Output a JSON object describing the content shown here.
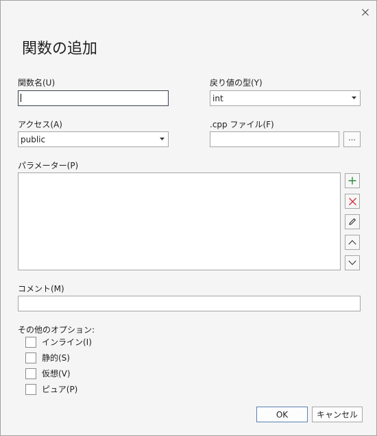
{
  "title": "関数の追加",
  "labels": {
    "function_name": "関数名(U)",
    "return_type": "戻り値の型(Y)",
    "access": "アクセス(A)",
    "cpp_file": ".cpp ファイル(F)",
    "parameters": "パラメーター(P)",
    "comment": "コメント(M)",
    "other_options": "その他のオプション:"
  },
  "fields": {
    "function_name": "",
    "return_type": "int",
    "access": "public",
    "cpp_file": "",
    "comment": ""
  },
  "browse_label": "...",
  "options": [
    {
      "label": "インライン(I)",
      "checked": false
    },
    {
      "label": "静的(S)",
      "checked": false
    },
    {
      "label": "仮想(V)",
      "checked": false
    },
    {
      "label": "ピュア(P)",
      "checked": false
    }
  ],
  "buttons": {
    "ok": "OK",
    "cancel": "キャンセル"
  },
  "icons": {
    "close": "close-icon",
    "add": "plus-icon",
    "remove": "x-icon",
    "edit": "pencil-icon",
    "up": "chevron-up-icon",
    "down": "chevron-down-icon"
  },
  "colors": {
    "add": "#2e8b3a",
    "remove": "#d62d3a"
  }
}
